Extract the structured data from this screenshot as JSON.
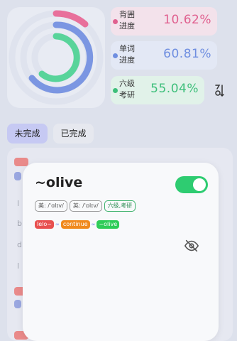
{
  "stats": [
    {
      "label": "背囲进度",
      "value": "10.62%",
      "color": "#e0608f",
      "bg": "#f4e3ec"
    },
    {
      "label": "单词进度",
      "value": "60.81%",
      "color": "#6f8ee0",
      "bg": "#e3e8f5"
    },
    {
      "label": "六级考研",
      "value": "55.04%",
      "color": "#3dbf7a",
      "bg": "#e1f2e9"
    }
  ],
  "sort_icon": "sort-icon",
  "tabs": {
    "incomplete": "未完成",
    "complete": "已完成"
  },
  "popup": {
    "word": "~olive",
    "toggle_on": true,
    "tags": [
      "美: /ˈɑlɪv/",
      "英: /ˈɒlɪv/",
      "六级,考研"
    ],
    "morphemes": [
      {
        "text": "lelo~",
        "color": "#e8504f"
      },
      {
        "text": "continue",
        "color": "#f08a1c"
      },
      {
        "text": "~olive",
        "color": "#2ecc58"
      }
    ],
    "link_symbol": "∞",
    "hide_icon": "eye-off-icon"
  }
}
